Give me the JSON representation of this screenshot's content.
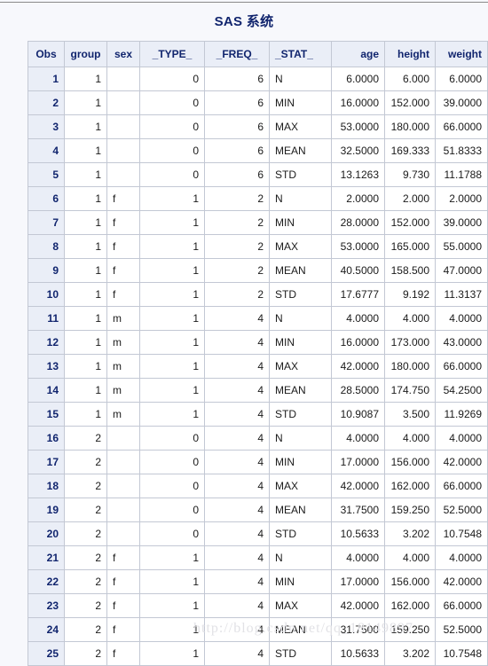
{
  "page": {
    "title": "SAS 系统",
    "watermark": "http://blog.csdn.net/qq_18149897",
    "colors": {
      "background": "#f7f8fc",
      "header_bg": "#eaeef7",
      "header_text": "#11256e",
      "border": "#c3c8d4",
      "body_text": "#1a1a1a",
      "watermark": "#e2e2e6",
      "top_rule": "#8a8a8a"
    }
  },
  "table": {
    "columns": [
      {
        "key": "obs",
        "label": "Obs",
        "align": "center"
      },
      {
        "key": "group",
        "label": "group",
        "align": "center"
      },
      {
        "key": "sex",
        "label": "sex",
        "align": "center"
      },
      {
        "key": "type",
        "label": "_TYPE_",
        "align": "center"
      },
      {
        "key": "freq",
        "label": "_FREQ_",
        "align": "center"
      },
      {
        "key": "stat",
        "label": "_STAT_",
        "align": "left"
      },
      {
        "key": "age",
        "label": "age",
        "align": "right"
      },
      {
        "key": "height",
        "label": "height",
        "align": "right"
      },
      {
        "key": "weight",
        "label": "weight",
        "align": "right"
      }
    ],
    "rows": [
      {
        "obs": "1",
        "group": "1",
        "sex": "",
        "type": "0",
        "freq": "6",
        "stat": "N",
        "age": "6.0000",
        "height": "6.000",
        "weight": "6.0000"
      },
      {
        "obs": "2",
        "group": "1",
        "sex": "",
        "type": "0",
        "freq": "6",
        "stat": "MIN",
        "age": "16.0000",
        "height": "152.000",
        "weight": "39.0000"
      },
      {
        "obs": "3",
        "group": "1",
        "sex": "",
        "type": "0",
        "freq": "6",
        "stat": "MAX",
        "age": "53.0000",
        "height": "180.000",
        "weight": "66.0000"
      },
      {
        "obs": "4",
        "group": "1",
        "sex": "",
        "type": "0",
        "freq": "6",
        "stat": "MEAN",
        "age": "32.5000",
        "height": "169.333",
        "weight": "51.8333"
      },
      {
        "obs": "5",
        "group": "1",
        "sex": "",
        "type": "0",
        "freq": "6",
        "stat": "STD",
        "age": "13.1263",
        "height": "9.730",
        "weight": "11.1788"
      },
      {
        "obs": "6",
        "group": "1",
        "sex": "f",
        "type": "1",
        "freq": "2",
        "stat": "N",
        "age": "2.0000",
        "height": "2.000",
        "weight": "2.0000"
      },
      {
        "obs": "7",
        "group": "1",
        "sex": "f",
        "type": "1",
        "freq": "2",
        "stat": "MIN",
        "age": "28.0000",
        "height": "152.000",
        "weight": "39.0000"
      },
      {
        "obs": "8",
        "group": "1",
        "sex": "f",
        "type": "1",
        "freq": "2",
        "stat": "MAX",
        "age": "53.0000",
        "height": "165.000",
        "weight": "55.0000"
      },
      {
        "obs": "9",
        "group": "1",
        "sex": "f",
        "type": "1",
        "freq": "2",
        "stat": "MEAN",
        "age": "40.5000",
        "height": "158.500",
        "weight": "47.0000"
      },
      {
        "obs": "10",
        "group": "1",
        "sex": "f",
        "type": "1",
        "freq": "2",
        "stat": "STD",
        "age": "17.6777",
        "height": "9.192",
        "weight": "11.3137"
      },
      {
        "obs": "11",
        "group": "1",
        "sex": "m",
        "type": "1",
        "freq": "4",
        "stat": "N",
        "age": "4.0000",
        "height": "4.000",
        "weight": "4.0000"
      },
      {
        "obs": "12",
        "group": "1",
        "sex": "m",
        "type": "1",
        "freq": "4",
        "stat": "MIN",
        "age": "16.0000",
        "height": "173.000",
        "weight": "43.0000"
      },
      {
        "obs": "13",
        "group": "1",
        "sex": "m",
        "type": "1",
        "freq": "4",
        "stat": "MAX",
        "age": "42.0000",
        "height": "180.000",
        "weight": "66.0000"
      },
      {
        "obs": "14",
        "group": "1",
        "sex": "m",
        "type": "1",
        "freq": "4",
        "stat": "MEAN",
        "age": "28.5000",
        "height": "174.750",
        "weight": "54.2500"
      },
      {
        "obs": "15",
        "group": "1",
        "sex": "m",
        "type": "1",
        "freq": "4",
        "stat": "STD",
        "age": "10.9087",
        "height": "3.500",
        "weight": "11.9269"
      },
      {
        "obs": "16",
        "group": "2",
        "sex": "",
        "type": "0",
        "freq": "4",
        "stat": "N",
        "age": "4.0000",
        "height": "4.000",
        "weight": "4.0000"
      },
      {
        "obs": "17",
        "group": "2",
        "sex": "",
        "type": "0",
        "freq": "4",
        "stat": "MIN",
        "age": "17.0000",
        "height": "156.000",
        "weight": "42.0000"
      },
      {
        "obs": "18",
        "group": "2",
        "sex": "",
        "type": "0",
        "freq": "4",
        "stat": "MAX",
        "age": "42.0000",
        "height": "162.000",
        "weight": "66.0000"
      },
      {
        "obs": "19",
        "group": "2",
        "sex": "",
        "type": "0",
        "freq": "4",
        "stat": "MEAN",
        "age": "31.7500",
        "height": "159.250",
        "weight": "52.5000"
      },
      {
        "obs": "20",
        "group": "2",
        "sex": "",
        "type": "0",
        "freq": "4",
        "stat": "STD",
        "age": "10.5633",
        "height": "3.202",
        "weight": "10.7548"
      },
      {
        "obs": "21",
        "group": "2",
        "sex": "f",
        "type": "1",
        "freq": "4",
        "stat": "N",
        "age": "4.0000",
        "height": "4.000",
        "weight": "4.0000"
      },
      {
        "obs": "22",
        "group": "2",
        "sex": "f",
        "type": "1",
        "freq": "4",
        "stat": "MIN",
        "age": "17.0000",
        "height": "156.000",
        "weight": "42.0000"
      },
      {
        "obs": "23",
        "group": "2",
        "sex": "f",
        "type": "1",
        "freq": "4",
        "stat": "MAX",
        "age": "42.0000",
        "height": "162.000",
        "weight": "66.0000"
      },
      {
        "obs": "24",
        "group": "2",
        "sex": "f",
        "type": "1",
        "freq": "4",
        "stat": "MEAN",
        "age": "31.7500",
        "height": "159.250",
        "weight": "52.5000"
      },
      {
        "obs": "25",
        "group": "2",
        "sex": "f",
        "type": "1",
        "freq": "4",
        "stat": "STD",
        "age": "10.5633",
        "height": "3.202",
        "weight": "10.7548"
      }
    ]
  }
}
